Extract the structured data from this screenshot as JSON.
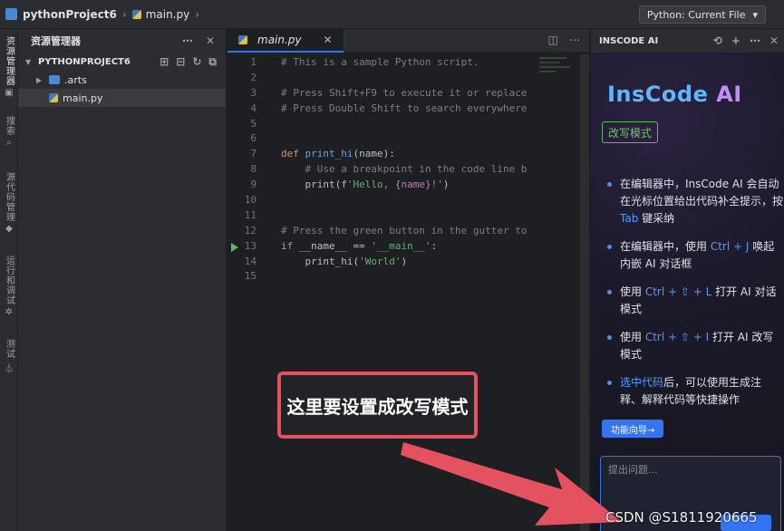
{
  "titlebar": {
    "project": "pythonProject6",
    "file": "main.py",
    "interpreter": "Python: Current File"
  },
  "activity": {
    "items": [
      "资源管理器",
      "搜索",
      "源代码管理",
      "运行和调试",
      "测试"
    ]
  },
  "explorer": {
    "title": "资源管理器",
    "root": "PYTHONPROJECT6",
    "items": [
      ".arts",
      "main.py"
    ]
  },
  "editor": {
    "tab_label": "main.py",
    "line_numbers": [
      "1",
      "2",
      "3",
      "4",
      "5",
      "6",
      "7",
      "8",
      "9",
      "10",
      "11",
      "12",
      "13",
      "14",
      "15"
    ],
    "code": {
      "l1": "# This is a sample Python script.",
      "l3": "# Press Shift+F9 to execute it or replace",
      "l4": "# Press Double Shift to search everywhere",
      "l7_kw": "def ",
      "l7_fn": "print_hi",
      "l7_rest": "(name):",
      "l8": "    # Use a breakpoint in the code line b",
      "l9_fn": "    print",
      "l9_a": "(f",
      "l9_str1": "'Hello, ",
      "l9_var": "{name}",
      "l9_str2": "!'",
      "l9_b": ")",
      "l12": "# Press the green button in the gutter to",
      "l13_kw": "if ",
      "l13_a": "__name__ == ",
      "l13_str": "'__main__'",
      "l13_b": ":",
      "l14_a": "    print_hi(",
      "l14_str": "'World'",
      "l14_b": ")"
    }
  },
  "ai_panel": {
    "title": "INSCODE AI",
    "logo_main": "InsCode ",
    "logo_ai": "AI",
    "mode_badge": "改写模式",
    "bullets": [
      {
        "pre": "在编辑器中，InsCode AI 会自动在光标位置给出代码补全提示，按 ",
        "hl": "Tab",
        "post": " 键采纳"
      },
      {
        "pre": "在编辑器中，使用 ",
        "hl": "Ctrl + J",
        "post": " 唤起内嵌 AI 对话框"
      },
      {
        "pre": "使用 ",
        "hl": "Ctrl + ⇧ + L",
        "post": " 打开 AI 对话模式"
      },
      {
        "pre": "使用 ",
        "hl": "Ctrl + ⇧ + I",
        "post": " 打开 AI 改写模式"
      },
      {
        "pre": "",
        "hl": "选中代码",
        "post": "后，可以使用生成注释、解释代码等快捷操作"
      }
    ],
    "guide_button": "功能向导→",
    "ask_placeholder": "提出问题..."
  },
  "annotation": {
    "callout_text": "这里要设置成改写模式",
    "callout_color": "#e5525f"
  },
  "watermark": "CSDN @S1811920665"
}
